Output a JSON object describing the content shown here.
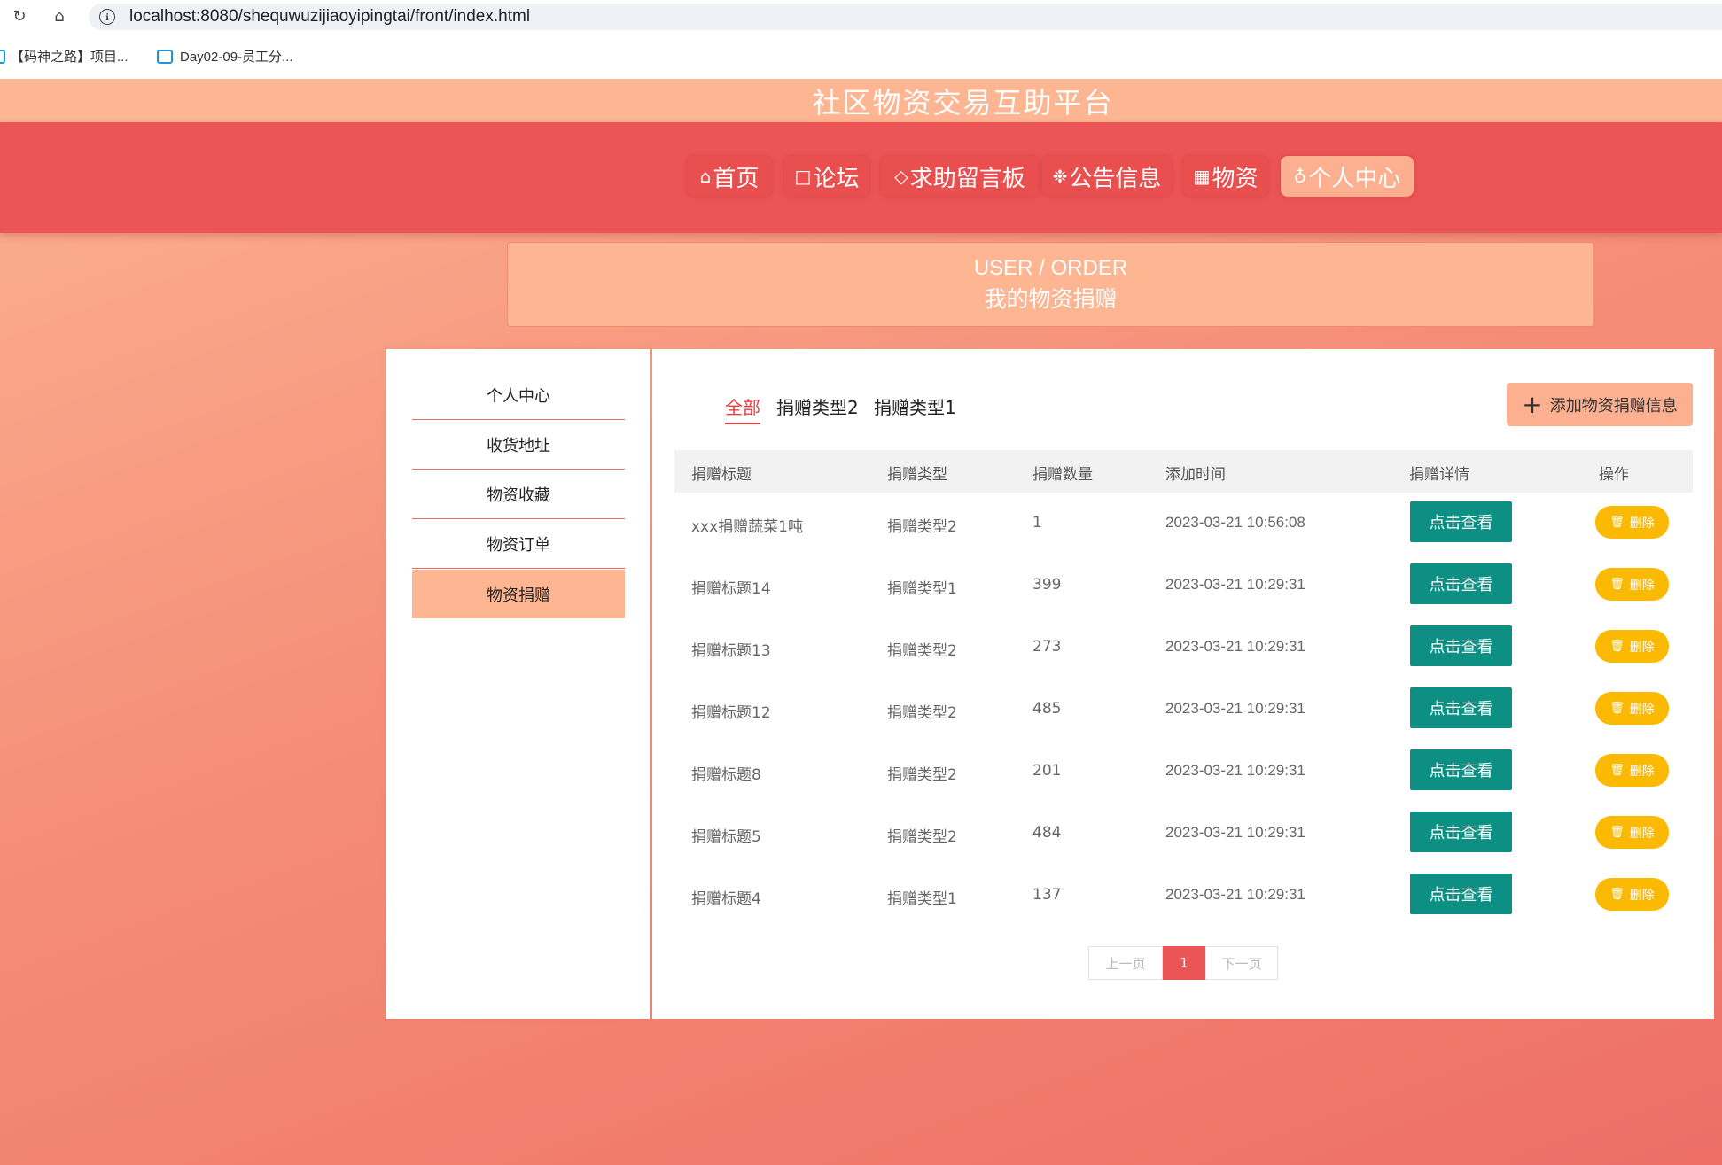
{
  "browser": {
    "url": "localhost:8080/shequwuzijiaoyipingtai/front/index.html",
    "bookmarks": [
      "【码神之路】项目...",
      "Day02-09-员工分..."
    ]
  },
  "header": {
    "title": "社区物资交易互助平台",
    "nav": [
      {
        "label": "首页",
        "icon": "home-icon"
      },
      {
        "label": "论坛",
        "icon": "note-icon"
      },
      {
        "label": "求助留言板",
        "icon": "tag-icon"
      },
      {
        "label": "公告信息",
        "icon": "snowflake-icon"
      },
      {
        "label": "物资",
        "icon": "grid-icon"
      },
      {
        "label": "个人中心",
        "icon": "user-icon",
        "active": true
      }
    ]
  },
  "banner": {
    "en": "USER / ORDER",
    "cn": "我的物资捐赠"
  },
  "sidebar": {
    "items": [
      {
        "label": "个人中心"
      },
      {
        "label": "收货地址"
      },
      {
        "label": "物资收藏"
      },
      {
        "label": "物资订单"
      },
      {
        "label": "物资捐赠",
        "active": true
      }
    ]
  },
  "main": {
    "tabs": [
      {
        "label": "全部",
        "active": true
      },
      {
        "label": "捐赠类型2"
      },
      {
        "label": "捐赠类型1"
      }
    ],
    "add_button": "添加物资捐赠信息",
    "columns": [
      "捐赠标题",
      "捐赠类型",
      "捐赠数量",
      "添加时间",
      "捐赠详情",
      "操作"
    ],
    "view_label": "点击查看",
    "delete_label": "删除",
    "rows": [
      {
        "title": "xxx捐赠蔬菜1吨",
        "type": "捐赠类型2",
        "qty": "1",
        "time": "2023-03-21 10:56:08"
      },
      {
        "title": "捐赠标题14",
        "type": "捐赠类型1",
        "qty": "399",
        "time": "2023-03-21 10:29:31"
      },
      {
        "title": "捐赠标题13",
        "type": "捐赠类型2",
        "qty": "273",
        "time": "2023-03-21 10:29:31"
      },
      {
        "title": "捐赠标题12",
        "type": "捐赠类型2",
        "qty": "485",
        "time": "2023-03-21 10:29:31"
      },
      {
        "title": "捐赠标题8",
        "type": "捐赠类型2",
        "qty": "201",
        "time": "2023-03-21 10:29:31"
      },
      {
        "title": "捐赠标题5",
        "type": "捐赠类型2",
        "qty": "484",
        "time": "2023-03-21 10:29:31"
      },
      {
        "title": "捐赠标题4",
        "type": "捐赠类型1",
        "qty": "137",
        "time": "2023-03-21 10:29:31"
      }
    ],
    "pager": {
      "prev": "上一页",
      "current": "1",
      "next": "下一页"
    }
  },
  "colors": {
    "accent": "#ec5555",
    "peach": "#feb592",
    "view_button": "#0e8f84",
    "delete_button": "#fbb901"
  }
}
